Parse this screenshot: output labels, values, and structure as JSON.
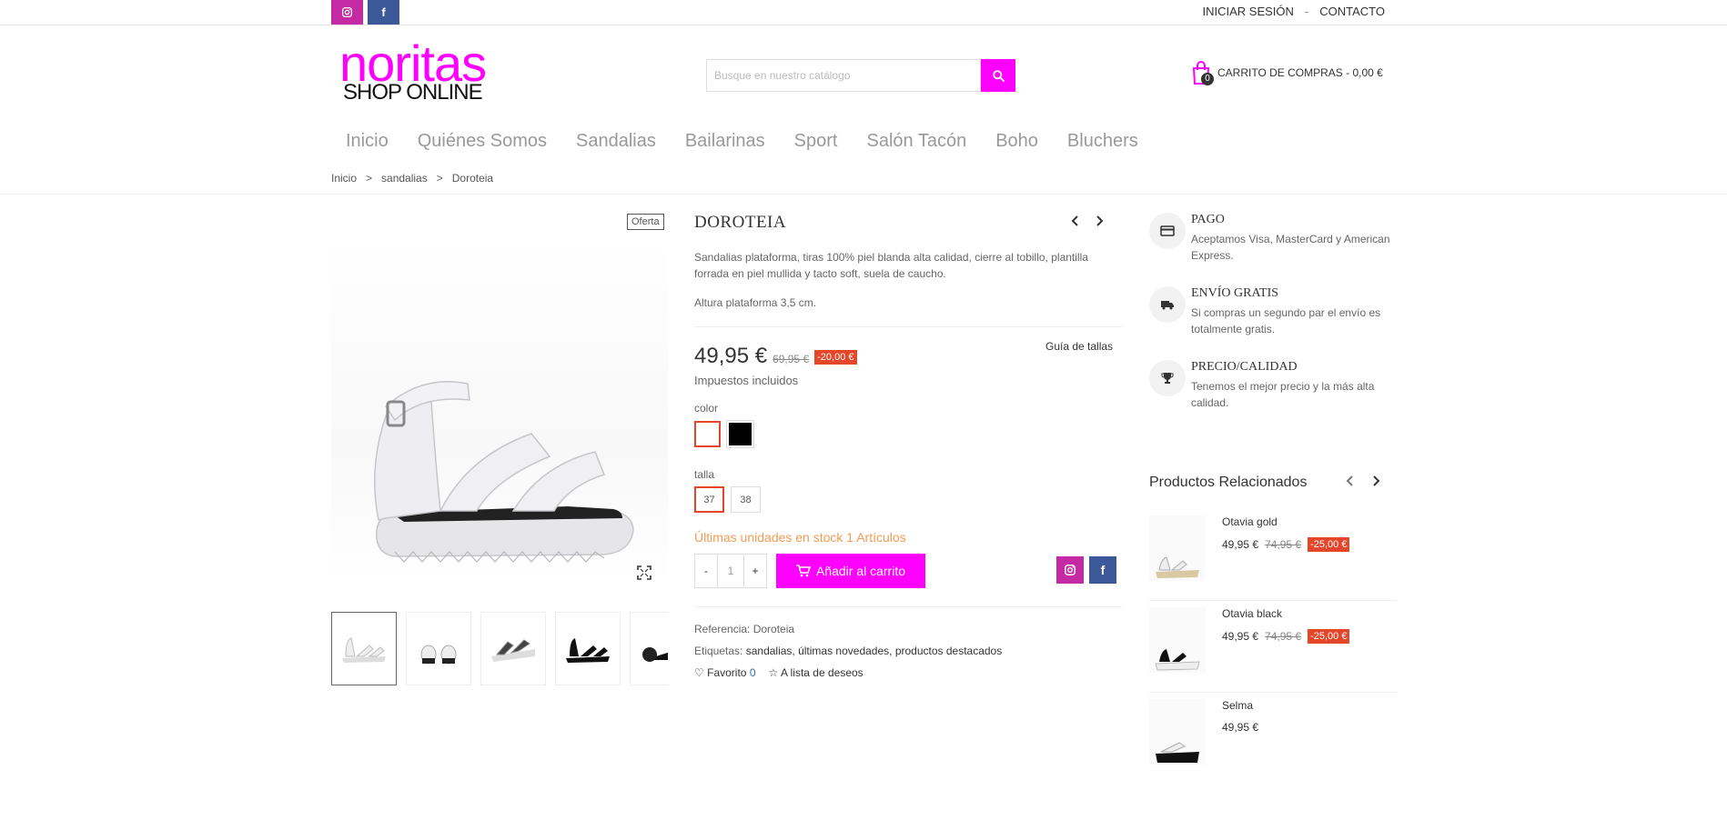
{
  "topbar": {
    "links": [
      "INICIAR SESIÓN",
      "-",
      "CONTACTO"
    ]
  },
  "brand": {
    "name": "noritas",
    "tagline": "SHOP ONLINE",
    "color": "#ff00ff"
  },
  "search": {
    "placeholder": "Busque en nuestro catálogo"
  },
  "cart": {
    "count": "0",
    "label": "CARRITO DE COMPRAS - 0,00 €"
  },
  "nav": [
    "Inicio",
    "Quiénes Somos",
    "Sandalias",
    "Bailarinas",
    "Sport",
    "Salón Tacón",
    "Boho",
    "Bluchers"
  ],
  "breadcrumb": [
    "Inicio",
    ">",
    "sandalias",
    ">",
    "Doroteia"
  ],
  "product": {
    "badge": "Oferta",
    "title": "DOROTEIA",
    "description": "Sandalias plataforma, tiras 100% piel blanda alta calidad, cierre al tobillo, plantilla forrada en piel mullida y tacto soft, suela de caucho.",
    "description2": "Altura plataforma 3,5 cm.",
    "price": "49,95 €",
    "old_price": "69,95 €",
    "discount": "-20,00 €",
    "size_guide": "Guía de tallas",
    "tax": "Impuestos incluidos",
    "color_label": "color",
    "size_label": "talla",
    "sizes": [
      "37",
      "38"
    ],
    "stock": "Últimas unidades en stock 1 Artículos",
    "qty_minus": "-",
    "qty_value": "1",
    "qty_plus": "+",
    "add_to_cart": "Añadir al carrito",
    "reference": "Referencia: Doroteia",
    "tags_label": "Etiquetas:",
    "tags": "sandalias, últimas novedades, productos destacados",
    "favorite": "Favorito",
    "favorite_count": "0",
    "wishlist": "A lista de deseos"
  },
  "info": [
    {
      "title": "PAGO",
      "text": "Aceptamos Visa, MasterCard y American Express.",
      "icon": "card-icon"
    },
    {
      "title": "ENVÍO GRATIS",
      "text": "Si compras un segundo par el envío es totalmente gratis.",
      "icon": "truck-icon"
    },
    {
      "title": "PRECIO/CALIDAD",
      "text": "Tenemos el mejor precio y la más alta calidad.",
      "icon": "trophy-icon"
    }
  ],
  "related": {
    "title": "Productos Relacionados",
    "items": [
      {
        "name": "Otavia gold",
        "price": "49,95 €",
        "old": "74,95 €",
        "disc": "-25,00 €"
      },
      {
        "name": "Otavia black",
        "price": "49,95 €",
        "old": "74,95 €",
        "disc": "-25,00 €"
      },
      {
        "name": "Selma",
        "price": "49,95 €"
      }
    ]
  }
}
